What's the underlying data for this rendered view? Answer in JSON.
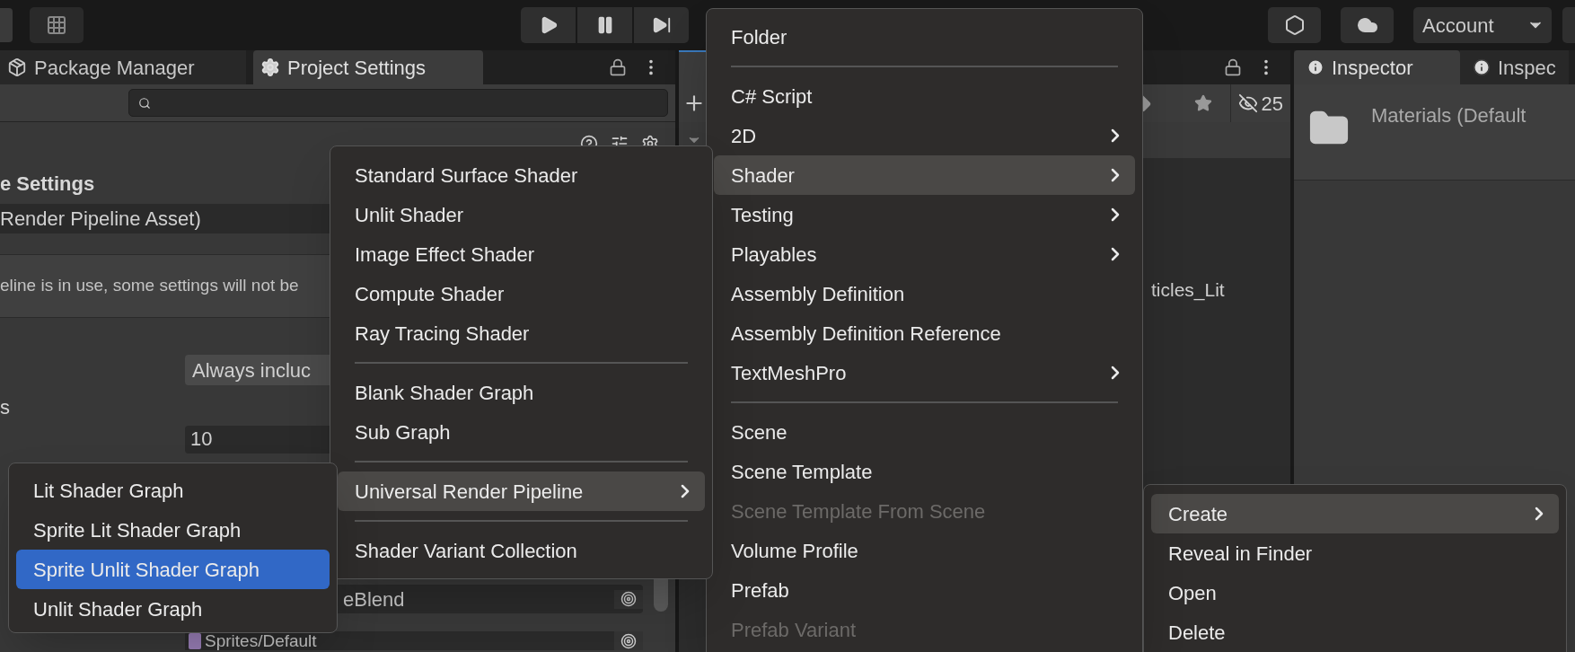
{
  "toolbar": {
    "play_buttons": [
      {
        "kind": "play"
      },
      {
        "kind": "pause"
      },
      {
        "kind": "step"
      }
    ],
    "account": "Account"
  },
  "project_settings_panel": {
    "tabs": [
      {
        "label": "Package Manager",
        "selected": false
      },
      {
        "label": "Project Settings",
        "selected": true
      }
    ],
    "section_title": "e Settings",
    "asset_field": "Render Pipeline Asset)",
    "help_text": "eline is in use, some settings will not be",
    "dropdown": "Always incluc",
    "label": "s",
    "number_field": "10",
    "object_fields": [
      "eBlend",
      "Sprites/Default"
    ]
  },
  "project_panel": {
    "hidden_count": "25",
    "asset_name": "ticles_Lit"
  },
  "inspector_panel": {
    "tabs": [
      {
        "label": "Inspector",
        "selected": true
      },
      {
        "label": "Inspec",
        "selected": false
      }
    ],
    "title": "Materials (Default"
  },
  "context_menu": [
    {
      "kind": "item",
      "label": "Create",
      "submenu": true,
      "selected": true,
      "disabled": false
    },
    {
      "kind": "item",
      "label": "Reveal in Finder",
      "submenu": false,
      "selected": false,
      "disabled": false
    },
    {
      "kind": "item",
      "label": "Open",
      "submenu": false,
      "selected": false,
      "disabled": false
    },
    {
      "kind": "item",
      "label": "Delete",
      "submenu": false,
      "selected": false,
      "disabled": false
    }
  ],
  "create_menu": [
    {
      "kind": "item",
      "label": "Folder",
      "submenu": false,
      "selected": false,
      "disabled": false
    },
    {
      "kind": "separator"
    },
    {
      "kind": "item",
      "label": "C# Script",
      "submenu": false,
      "selected": false,
      "disabled": false
    },
    {
      "kind": "item",
      "label": "2D",
      "submenu": true,
      "selected": false,
      "disabled": false
    },
    {
      "kind": "item",
      "label": "Shader",
      "submenu": true,
      "selected": true,
      "disabled": false
    },
    {
      "kind": "item",
      "label": "Testing",
      "submenu": true,
      "selected": false,
      "disabled": false
    },
    {
      "kind": "item",
      "label": "Playables",
      "submenu": true,
      "selected": false,
      "disabled": false
    },
    {
      "kind": "item",
      "label": "Assembly Definition",
      "submenu": false,
      "selected": false,
      "disabled": false
    },
    {
      "kind": "item",
      "label": "Assembly Definition Reference",
      "submenu": false,
      "selected": false,
      "disabled": false
    },
    {
      "kind": "item",
      "label": "TextMeshPro",
      "submenu": true,
      "selected": false,
      "disabled": false
    },
    {
      "kind": "separator"
    },
    {
      "kind": "item",
      "label": "Scene",
      "submenu": false,
      "selected": false,
      "disabled": false
    },
    {
      "kind": "item",
      "label": "Scene Template",
      "submenu": false,
      "selected": false,
      "disabled": false
    },
    {
      "kind": "item",
      "label": "Scene Template From Scene",
      "submenu": false,
      "selected": false,
      "disabled": true
    },
    {
      "kind": "item",
      "label": "Volume Profile",
      "submenu": false,
      "selected": false,
      "disabled": false
    },
    {
      "kind": "item",
      "label": "Prefab",
      "submenu": false,
      "selected": false,
      "disabled": false
    },
    {
      "kind": "item",
      "label": "Prefab Variant",
      "submenu": false,
      "selected": false,
      "disabled": true
    }
  ],
  "shader_menu": [
    {
      "kind": "item",
      "label": "Standard Surface Shader",
      "submenu": false,
      "selected": false,
      "disabled": false
    },
    {
      "kind": "item",
      "label": "Unlit Shader",
      "submenu": false,
      "selected": false,
      "disabled": false
    },
    {
      "kind": "item",
      "label": "Image Effect Shader",
      "submenu": false,
      "selected": false,
      "disabled": false
    },
    {
      "kind": "item",
      "label": "Compute Shader",
      "submenu": false,
      "selected": false,
      "disabled": false
    },
    {
      "kind": "item",
      "label": "Ray Tracing Shader",
      "submenu": false,
      "selected": false,
      "disabled": false
    },
    {
      "kind": "separator"
    },
    {
      "kind": "item",
      "label": "Blank Shader Graph",
      "submenu": false,
      "selected": false,
      "disabled": false
    },
    {
      "kind": "item",
      "label": "Sub Graph",
      "submenu": false,
      "selected": false,
      "disabled": false
    },
    {
      "kind": "separator"
    },
    {
      "kind": "item",
      "label": "Universal Render Pipeline",
      "submenu": true,
      "selected": true,
      "disabled": false
    },
    {
      "kind": "separator"
    },
    {
      "kind": "item",
      "label": "Shader Variant Collection",
      "submenu": false,
      "selected": false,
      "disabled": false
    }
  ],
  "urp_menu": [
    {
      "kind": "item",
      "label": "Lit Shader Graph",
      "submenu": false,
      "selected": false,
      "disabled": false
    },
    {
      "kind": "item",
      "label": "Sprite Lit Shader Graph",
      "submenu": false,
      "selected": false,
      "disabled": false
    },
    {
      "kind": "item",
      "label": "Sprite Unlit Shader Graph",
      "submenu": false,
      "selected": true,
      "disabled": false
    },
    {
      "kind": "item",
      "label": "Unlit Shader Graph",
      "submenu": false,
      "selected": false,
      "disabled": false
    }
  ]
}
